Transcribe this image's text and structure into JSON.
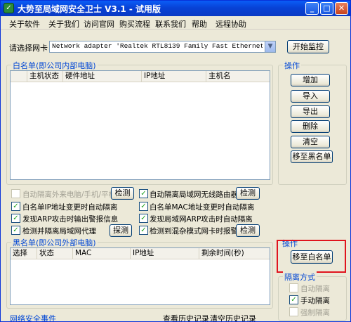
{
  "window": {
    "title": "大势至局域网安全卫士 V3.1 - 试用版",
    "minimize_icon": "minimize-icon",
    "maximize_icon": "maximize-icon",
    "close_icon": "close-icon"
  },
  "menu": [
    "关于软件",
    "关于我们",
    "访问官网",
    "购买流程",
    "联系我们",
    "帮助",
    "远程协助"
  ],
  "adapter": {
    "label": "请选择网卡",
    "value": "Network adapter 'Realtek RTL8139 Family Fast Ethernet Adapter' ·",
    "start_button": "开始监控"
  },
  "whitelist": {
    "title": "白名单(即公司内部电脑)",
    "columns": [
      "主机状态",
      "硬件地址",
      "IP地址",
      "主机名"
    ]
  },
  "ops": {
    "title": "操作",
    "buttons": [
      "增加",
      "导入",
      "导出",
      "删除",
      "清空",
      "移至黑名单"
    ]
  },
  "options": {
    "auto_isolate_external": "自动隔离外来电脑/手机/平板",
    "detect1": "检测",
    "auto_isolate_wireless": "自动隔离局域网无线路由器",
    "detect2": "检测",
    "whitelist_ip_change": "白名单IP地址变更时自动隔离",
    "whitelist_mac_change": "白名单MAC地址变更时自动隔离",
    "arp_alert": "发现ARP攻击时输出警报信息",
    "arp_isolate": "发现局域网ARP攻击时自动隔离",
    "proxy_detect": "检测并隔离局域网代理",
    "probe": "探测",
    "promisc_alert": "检测到混杂模式网卡时报警",
    "detect3": "检测"
  },
  "blacklist": {
    "title": "黑名单(即公司外部电脑)",
    "columns": [
      "选择",
      "状态",
      "MAC",
      "IP地址",
      "剩余时间(秒)"
    ]
  },
  "ops2": {
    "title": "操作",
    "move_to_whitelist": "移至白名单"
  },
  "isolation": {
    "title": "隔离方式",
    "modes": [
      "自动隔离",
      "手动隔离",
      "强制隔离"
    ],
    "checked": [
      false,
      true,
      false
    ]
  },
  "footer": {
    "security_events": "网络安全事件",
    "history": "查看历史记录",
    "clear_history": "清空历史记录"
  }
}
